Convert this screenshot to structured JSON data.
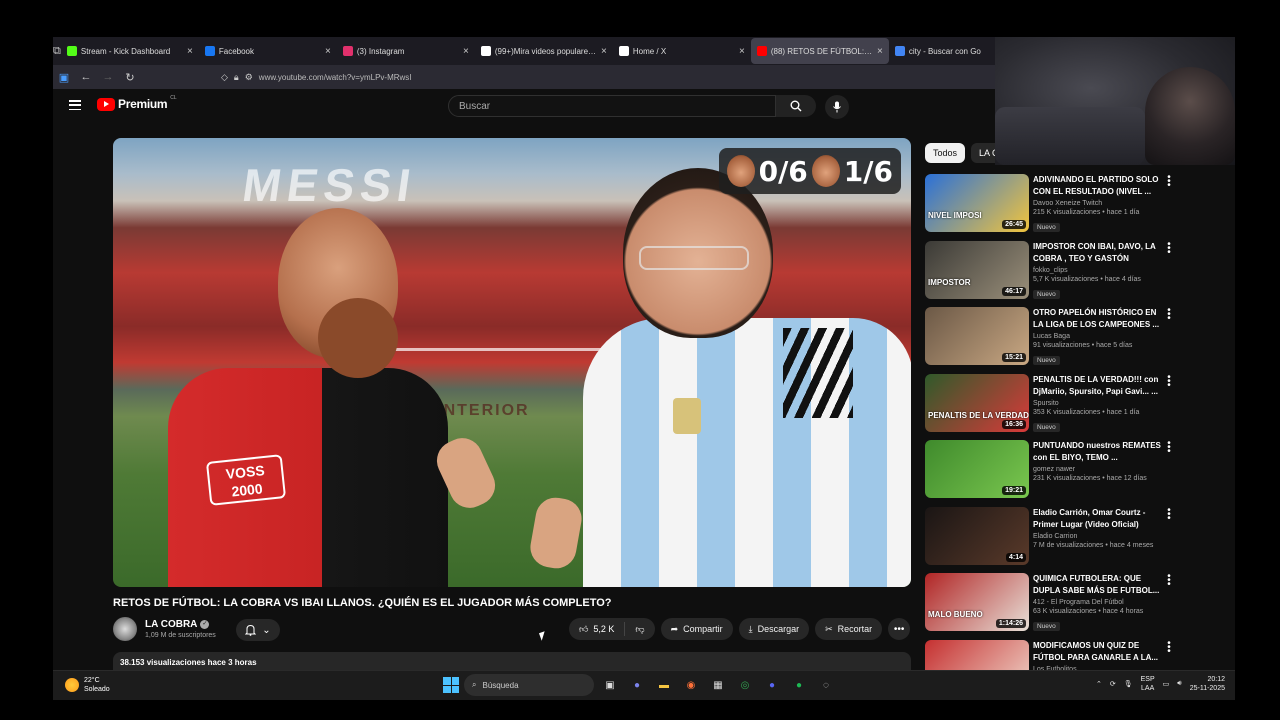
{
  "browser": {
    "tabs": [
      {
        "label": "Stream - Kick Dashboard",
        "icon": "kick-icon",
        "color": "#53fc18",
        "active": false
      },
      {
        "label": "Facebook",
        "icon": "facebook-icon",
        "color": "#1877f2",
        "active": false
      },
      {
        "label": "(3) Instagram",
        "icon": "instagram-icon",
        "color": "#e1306c",
        "active": false
      },
      {
        "label": "(99+)Mira videos populares sob",
        "icon": "tiktok-icon",
        "color": "#ffffff",
        "active": false
      },
      {
        "label": "Home / X",
        "icon": "x-icon",
        "color": "#ffffff",
        "active": false
      },
      {
        "label": "(88) RETOS DE FÚTBOL: LA",
        "icon": "youtube-icon",
        "color": "#ff0000",
        "active": true
      },
      {
        "label": "city - Buscar con Go",
        "icon": "google-icon",
        "color": "#4285f4",
        "active": false
      }
    ],
    "url": "www.youtube.com/watch?v=ymLPv-MRwsI"
  },
  "header": {
    "logo_text": "Premium",
    "logo_sup": "CL",
    "search_placeholder": "Buscar"
  },
  "video": {
    "score_left": "0/6",
    "score_right": "1/6",
    "stadium_text": "MESSI",
    "wall_text": "DEL INTERIOR",
    "sponsor_text": "VOSS 2000",
    "title": "RETOS DE FÚTBOL: LA COBRA VS IBAI LLANOS. ¿QUIÉN ES EL JUGADOR MÁS COMPLETO?",
    "channel": "LA COBRA",
    "subscribers": "1,09 M de suscriptores",
    "likes": "5,2 K",
    "share_label": "Compartir",
    "download_label": "Descargar",
    "clip_label": "Recortar",
    "views_line": "38.153 visualizaciones  hace 3 horas"
  },
  "chips": [
    "Todos",
    "LA C"
  ],
  "recommendations": [
    {
      "title": "ADIVINANDO EL PARTIDO SOLO CON EL RESULTADO (NIVEL ...",
      "channel": "Davoo Xeneize Twitch",
      "meta": "215 K visualizaciones • hace 1 día",
      "badge": "Nuevo",
      "duration": "26:45",
      "thumb_label": "NIVEL IMPOSI",
      "thumb_colors": [
        "#2a70d8",
        "#f2c53d"
      ]
    },
    {
      "title": "IMPOSTOR CON IBAI, DAVO, LA COBRA , TEO Y GASTÓN",
      "channel": "fokko_clips",
      "meta": "5,7 K visualizaciones • hace 4 días",
      "badge": "Nuevo",
      "duration": "46:17",
      "thumb_label": "IMPOSTOR",
      "thumb_colors": [
        "#3b3a36",
        "#9a8f7a"
      ]
    },
    {
      "title": "OTRO PAPELÓN HISTÓRICO EN LA LIGA DE LOS CAMPEONES ...",
      "channel": "Lucas Baga",
      "meta": "91 visualizaciones • hace 5 días",
      "badge": "Nuevo",
      "duration": "15:21",
      "thumb_label": "",
      "thumb_colors": [
        "#6b5846",
        "#c9a883"
      ]
    },
    {
      "title": "PENALTIS DE LA VERDAD!!! con DjMariio, Spursito, Papi Gavi... ...",
      "channel": "Spursito",
      "meta": "353 K visualizaciones • hace 1 día",
      "badge": "Nuevo",
      "duration": "16:36",
      "thumb_label": "PENALTIS DE LA VERDAD",
      "thumb_colors": [
        "#2f5a2a",
        "#d93a3a"
      ]
    },
    {
      "title": "PUNTUANDO nuestros REMATES con EL BIYO, TEMO ...",
      "channel": "gomez nawer",
      "meta": "231 K visualizaciones • hace 12 días",
      "badge": "",
      "duration": "19:21",
      "thumb_label": "",
      "thumb_colors": [
        "#3f8a2c",
        "#7ac74f"
      ]
    },
    {
      "title": "Eladio Carrión, Omar Courtz - Primer Lugar (Video Oficial)",
      "channel": "Eladio Carrion",
      "meta": "7 M de visualizaciones • hace 4 meses",
      "badge": "",
      "duration": "4:14",
      "thumb_label": "",
      "thumb_colors": [
        "#1a1514",
        "#5a3a2a"
      ]
    },
    {
      "title": "QUIMICA FUTBOLERA: QUE DUPLA SABE MÁS DE FUTBOL...",
      "channel": "412 - El Programa Del Fútbol",
      "meta": "63 K visualizaciones • hace 4 horas",
      "badge": "Nuevo",
      "duration": "1:14:26",
      "thumb_label": "MALO  BUENO",
      "thumb_colors": [
        "#b12525",
        "#e8e0d8"
      ]
    },
    {
      "title": "MODIFICAMOS UN QUIZ DE FÚTBOL PARA GANARLE A LA...",
      "channel": "Los Futbolitos",
      "meta": "",
      "badge": "",
      "duration": "",
      "thumb_label": "",
      "thumb_colors": [
        "#c53030",
        "#f0d8cc"
      ]
    }
  ],
  "taskbar": {
    "temperature": "22°C",
    "weather": "Soleado",
    "search_placeholder": "Búsqueda",
    "lang_top": "ESP",
    "lang_bottom": "LAA",
    "time": "20:12",
    "date": "25-11-2025"
  }
}
